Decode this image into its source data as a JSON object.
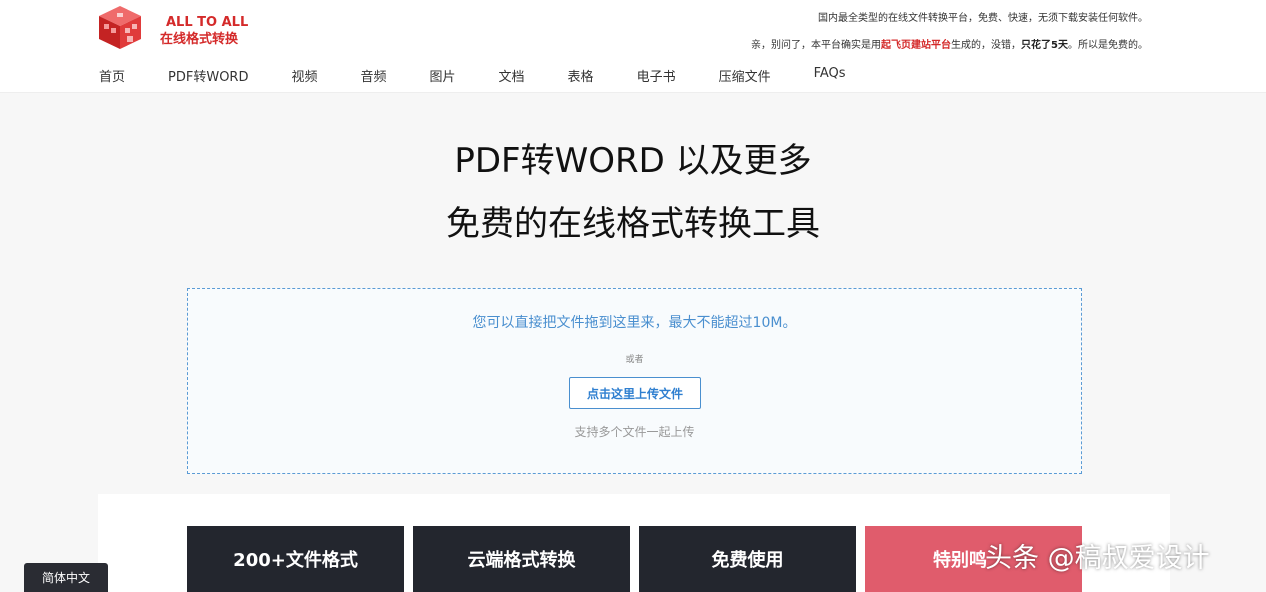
{
  "header": {
    "brand_line1": "ALL TO ALL",
    "brand_line2": "在线格式转换",
    "notice_line1": "国内最全类型的在线文件转换平台，免费、快速，无须下载安装任何软件。",
    "notice_line2_pre": "亲，别问了，本平台确实是用",
    "notice_line2_link": "起飞页建站平台",
    "notice_line2_mid": "生成的，没错，",
    "notice_line2_bold": "只花了5天",
    "notice_line2_post": "。所以是免费的。"
  },
  "nav": {
    "items": [
      {
        "label": "首页"
      },
      {
        "label": "PDF转WORD"
      },
      {
        "label": "视频"
      },
      {
        "label": "音频"
      },
      {
        "label": "图片"
      },
      {
        "label": "文档"
      },
      {
        "label": "表格"
      },
      {
        "label": "电子书"
      },
      {
        "label": "压缩文件"
      },
      {
        "label": "FAQs"
      }
    ]
  },
  "hero": {
    "line1": "PDF转WORD 以及更多",
    "line2": "免费的在线格式转换工具"
  },
  "dropzone": {
    "hint": "您可以直接把文件拖到这里来，最大不能超过10M。",
    "or": "或者",
    "upload_button": "点击这里上传文件",
    "multi": "支持多个文件一起上传"
  },
  "features": [
    {
      "label": "200+文件格式"
    },
    {
      "label": "云端格式转换"
    },
    {
      "label": "免费使用"
    },
    {
      "label": "特别鸣"
    }
  ],
  "watermark": "头条 @稿叔爱设计",
  "language": "简体中文",
  "colors": {
    "brand_red": "#d42a2a",
    "link_blue": "#2f7fd0",
    "dark_tile": "#23262e",
    "pink_tile": "#e05c6c"
  }
}
